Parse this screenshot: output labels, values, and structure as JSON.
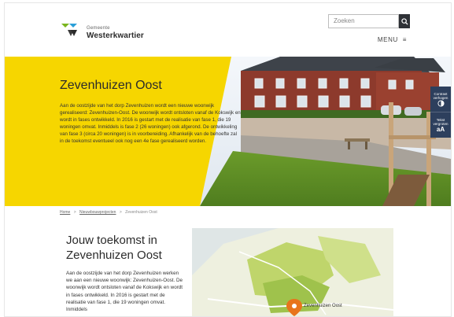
{
  "header": {
    "logo": {
      "small": "Gemeente",
      "big": "Westerkwartier"
    },
    "search": {
      "placeholder": "Zoeken"
    },
    "menu_label": "MENU"
  },
  "hero": {
    "title": "Zevenhuizen Oost",
    "paragraph": "Aan de oostzijde van het dorp Zevenhuizen wordt een nieuwe woonwijk gerealiseerd: Zevenhuizen-Oost. De woonwijk wordt ontsloten vanaf de Kokswijk en wordt in fases ontwikkeld. In 2016 is gestart met de realisatie van fase 1, die 19 woningen omvat. Inmiddels is fase 2 (26 woningen) ook afgerond. De ontwikkeling van fase 3 (circa 20 woningen) is in voorbereiding. Afhankelijk van de behoefte zal in de toekomst eventueel ook nog een 4e fase gerealiseerd worden."
  },
  "tools": {
    "contrast": {
      "label1": "Contrast",
      "label2": "verhogen"
    },
    "text": {
      "label1": "Tekst",
      "label2": "vergroten",
      "symbol": "aA"
    }
  },
  "breadcrumb": {
    "home": "Home",
    "news": "Nieuwbouwprojecten",
    "current": "Zevenhuizen Oost"
  },
  "lower": {
    "title_line1": "Jouw toekomst in",
    "title_line2": "Zevenhuizen Oost",
    "paragraph": "Aan de oostzijde van het dorp Zevenhuizen werken we aan een nieuwe woonwijk: Zevenhuizen-Oost. De woonwijk wordt ontsloten vanaf de Kokswijk en wordt in fases ontwikkeld. In 2016 is gestart met de realisatie van fase 1, die 19 woningen omvat. Inmiddels"
  },
  "map": {
    "label": "Zevenhuizen Oost"
  },
  "colors": {
    "yellow": "#f6d600",
    "dark": "#2e3136",
    "navy": "#2d3f5d",
    "green": "#7ab51d",
    "blue": "#2a9fd8",
    "pin": "#e8741b"
  }
}
